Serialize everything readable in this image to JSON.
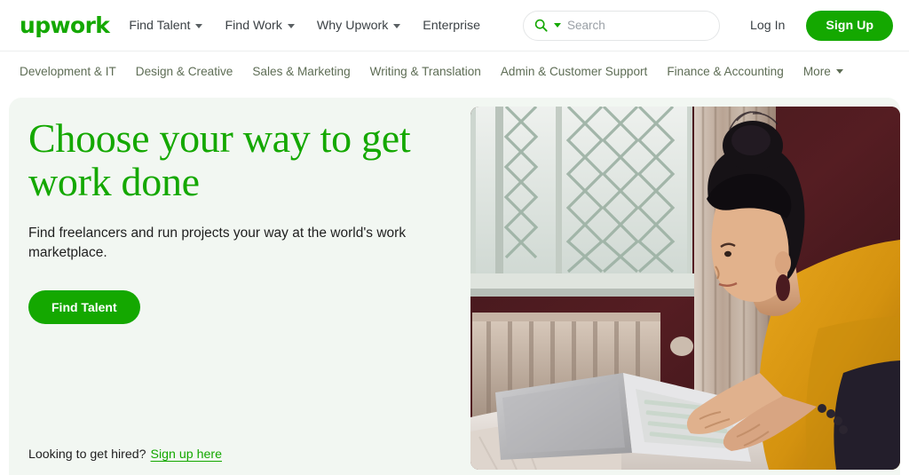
{
  "header": {
    "logo": "upwork",
    "nav": [
      {
        "label": "Find Talent",
        "caret": true,
        "icon": "chevron-down-icon"
      },
      {
        "label": "Find Work",
        "caret": true,
        "icon": "chevron-down-icon"
      },
      {
        "label": "Why Upwork",
        "caret": true,
        "icon": "chevron-down-icon"
      },
      {
        "label": "Enterprise",
        "caret": false,
        "icon": ""
      }
    ],
    "search": {
      "placeholder": "Search",
      "value": "",
      "icon": "search-icon",
      "caret_icon": "chevron-down-icon"
    },
    "login_label": "Log In",
    "signup_label": "Sign Up"
  },
  "categories": [
    {
      "label": "Development & IT",
      "caret": false
    },
    {
      "label": "Design & Creative",
      "caret": false
    },
    {
      "label": "Sales & Marketing",
      "caret": false
    },
    {
      "label": "Writing & Translation",
      "caret": false
    },
    {
      "label": "Admin & Customer Support",
      "caret": false
    },
    {
      "label": "Finance & Accounting",
      "caret": false
    },
    {
      "label": "More",
      "caret": true
    }
  ],
  "hero": {
    "title_line1": "Choose your way to get",
    "title_line2": "work done",
    "subtitle": "Find freelancers and run projects your way at the world's work marketplace.",
    "cta_label": "Find Talent",
    "footer_text": "Looking to get hired?",
    "footer_link": "Sign up here",
    "photo_alt": "woman in mustard sweater lying on bed typing on a silver laptop by a window"
  },
  "colors": {
    "brand_green": "#14a800",
    "hero_bg": "#f2f7f2",
    "nav_text": "#3c4246",
    "category_text": "#5e6d55",
    "white": "#ffffff"
  }
}
